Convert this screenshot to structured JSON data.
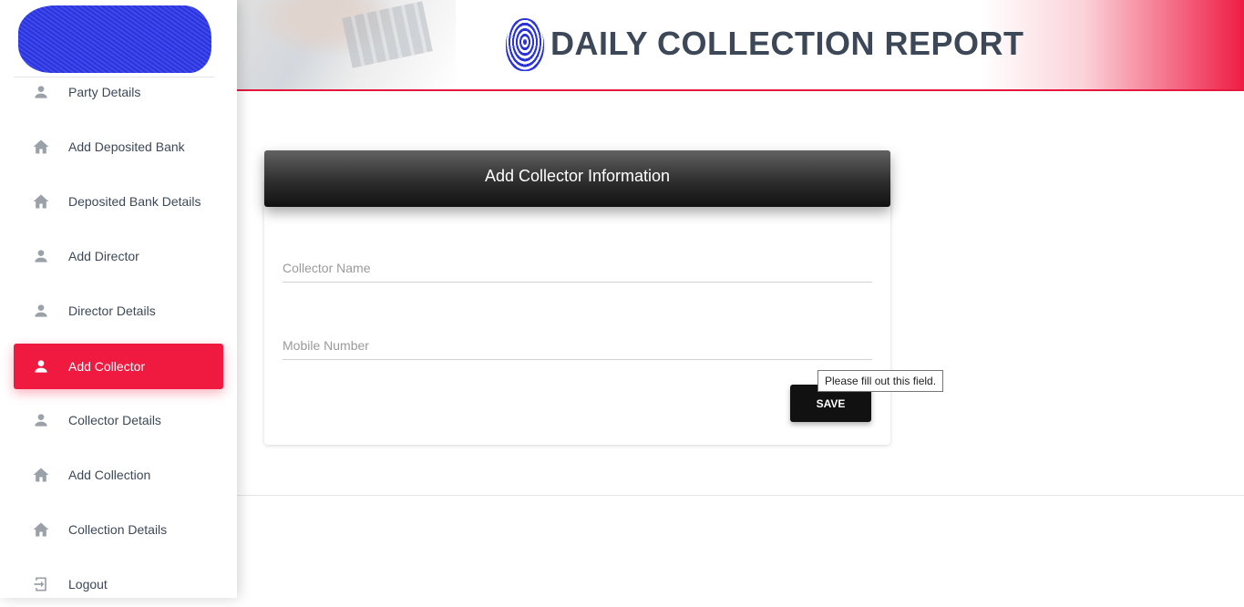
{
  "header": {
    "title": "DAILY COLLECTION REPORT"
  },
  "sidebar": {
    "items": [
      {
        "label": "Party Details",
        "icon": "person-icon",
        "active": false
      },
      {
        "label": "Add Deposited Bank",
        "icon": "home-icon",
        "active": false
      },
      {
        "label": "Deposited Bank Details",
        "icon": "home-icon",
        "active": false
      },
      {
        "label": "Add Director",
        "icon": "person-icon",
        "active": false
      },
      {
        "label": "Director Details",
        "icon": "person-icon",
        "active": false
      },
      {
        "label": "Add Collector",
        "icon": "person-icon",
        "active": true
      },
      {
        "label": "Collector Details",
        "icon": "person-icon",
        "active": false
      },
      {
        "label": "Add Collection",
        "icon": "home-icon",
        "active": false
      },
      {
        "label": "Collection Details",
        "icon": "home-icon",
        "active": false
      },
      {
        "label": "Logout",
        "icon": "logout-icon",
        "active": false
      }
    ]
  },
  "form": {
    "title": "Add Collector Information",
    "collector_name": {
      "placeholder": "Collector Name",
      "value": ""
    },
    "mobile_number": {
      "placeholder": "Mobile Number",
      "value": ""
    },
    "save_label": "SAVE",
    "validation_tooltip": "Please fill out this field."
  },
  "colors": {
    "accent": "#f01a41",
    "text": "#3c4858",
    "icon": "#9aa1a9",
    "header_dark": "#111111"
  }
}
